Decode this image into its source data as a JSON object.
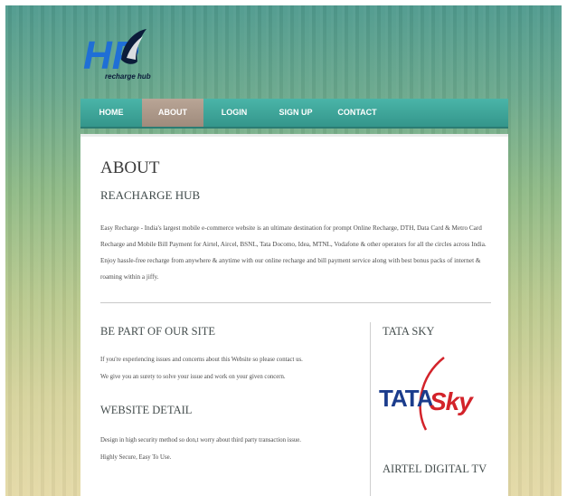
{
  "logo": {
    "initials": "HP",
    "sub": "recharge hub"
  },
  "nav": {
    "items": [
      {
        "label": "HOME"
      },
      {
        "label": "ABOUT"
      },
      {
        "label": "LOGIN"
      },
      {
        "label": "SIGN UP"
      },
      {
        "label": "CONTACT"
      }
    ],
    "active": "ABOUT"
  },
  "about": {
    "title": "ABOUT",
    "subtitle": "REACHARGE HUB",
    "body": "Easy Recharge - India's largest mobile e-commerce website is an ultimate destination for prompt Online Recharge, DTH, Data Card & Metro Card Recharge and Mobile Bill Payment for Airtel, Aircel, BSNL, Tata Docomo, Idea, MTNL, Vodafone & other operators for all the circles across India. Enjoy hassle-free recharge from anywhere & anytime with our online recharge and bill payment service along with best bonus packs of internet & roaming within a jiffy."
  },
  "part": {
    "title": "BE PART OF OUR SITE",
    "line1": "If you're experiencing issues and concerns about this Website so please contact us.",
    "line2": "We give you an surety to solve your issue and work on your given concern."
  },
  "website": {
    "title": "WEBSITE DETAIL",
    "line1": "Design in high security method so don,t worry about third party transaction issue.",
    "line2": "Highly Secure, Easy To Use."
  },
  "sidebar": {
    "tata_title": "TATA SKY",
    "tata_logo_a": "TATA",
    "tata_logo_b": "Sky",
    "airtel_title": "AIRTEL DIGITAL TV"
  },
  "colors": {
    "nav": "#3aa597",
    "nav_active": "#ab9787",
    "tata_blue": "#1b3c8c",
    "tata_red": "#d3232a"
  }
}
